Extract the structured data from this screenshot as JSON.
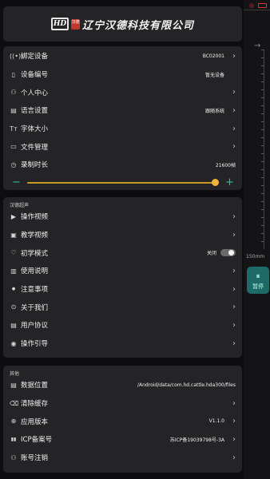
{
  "background_app": {
    "ruler_unit": "150mm",
    "button_label": "暂停"
  },
  "logo": {
    "mark": "HD",
    "seal": "汉德",
    "company": "辽宁汉德科技有限公司"
  },
  "settings": {
    "items": [
      {
        "icon": "antenna-icon",
        "glyph": "((•))",
        "label": "绑定设备",
        "value": "BC02001"
      },
      {
        "icon": "device-icon",
        "glyph": "▯",
        "label": "设备编号",
        "value": "暂无设备"
      },
      {
        "icon": "person-icon",
        "glyph": "⚇",
        "label": "个人中心",
        "value": ""
      },
      {
        "icon": "language-icon",
        "glyph": "▤",
        "label": "语言设置",
        "value": "跟随系统"
      },
      {
        "icon": "font-size-icon",
        "glyph": "Tт",
        "label": "字体大小",
        "value": ""
      },
      {
        "icon": "folder-icon",
        "glyph": "▭",
        "label": "文件管理",
        "value": ""
      },
      {
        "icon": "timer-icon",
        "glyph": "◷",
        "label": "录制时长",
        "value": "21600帧"
      }
    ],
    "slider": {
      "minus": "−",
      "plus": "+",
      "level": 0.99
    }
  },
  "hande_ultrasound": {
    "title": "汉德超声",
    "items": [
      {
        "icon": "video-icon",
        "glyph": "▶",
        "label": "操作视频",
        "value": ""
      },
      {
        "icon": "teaching-video-icon",
        "glyph": "▣",
        "label": "教学视频",
        "value": ""
      },
      {
        "icon": "beginner-icon",
        "glyph": "♡",
        "label": "初学模式",
        "value": "关闭"
      },
      {
        "icon": "book-icon",
        "glyph": "▥",
        "label": "使用说明",
        "value": ""
      },
      {
        "icon": "notice-icon",
        "glyph": "●",
        "label": "注意事项",
        "value": ""
      },
      {
        "icon": "about-icon",
        "glyph": "⊙",
        "label": "关于我们",
        "value": ""
      },
      {
        "icon": "agreement-icon",
        "glyph": "▤",
        "label": "用户协议",
        "value": ""
      },
      {
        "icon": "guide-icon",
        "glyph": "◉",
        "label": "操作引导",
        "value": ""
      }
    ]
  },
  "other": {
    "title": "其他",
    "items": [
      {
        "icon": "data-location-icon",
        "glyph": "▤",
        "label": "数据位置",
        "value": "/Android/data/com.hd.cattle.hda300/files"
      },
      {
        "icon": "clear-cache-icon",
        "glyph": "⌫",
        "label": "清除缓存",
        "value": ""
      },
      {
        "icon": "version-icon",
        "glyph": "⊕",
        "label": "应用版本",
        "value": "V1.1.0"
      },
      {
        "icon": "icp-icon",
        "glyph": "▮▮",
        "label": "ICP备案号",
        "value": "苏ICP备19039798号-3A"
      },
      {
        "icon": "account-cancel-icon",
        "glyph": "⚇",
        "label": "账号注销",
        "value": ""
      }
    ]
  }
}
